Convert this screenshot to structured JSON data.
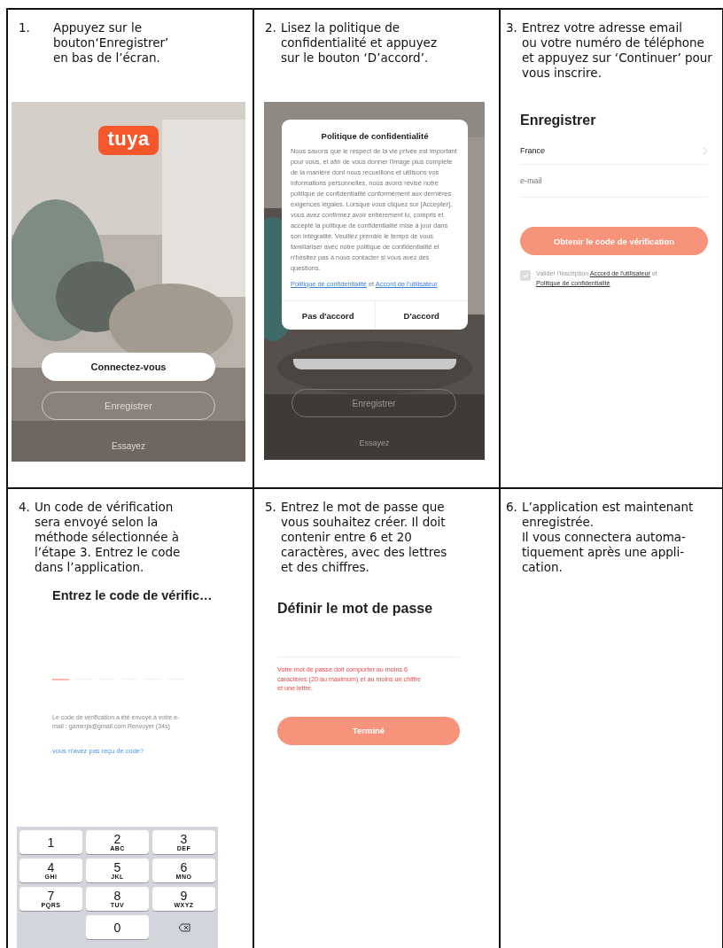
{
  "steps": [
    {
      "number": "1.",
      "text": "Appuyez sur le\nbouton‘Enregistrer’\nen bas de l’écran.",
      "screen": {
        "kind": "welcome",
        "logo": "tuya",
        "buttons": [
          {
            "label": "Connectez-vous",
            "kind": "solid"
          },
          {
            "label": "Enregistrer",
            "kind": "outline"
          }
        ],
        "link": "Essayez"
      }
    },
    {
      "number": "2.",
      "text": "Lisez la politique de\nconfidentialité et appuyez\nsur le bouton ‘D’accord’.",
      "screen": {
        "kind": "policy",
        "title": "Politique de confidentialité",
        "body": "Nous savons que le respect de la vie privée est important pour vous, et afin de vous donner l'image plus complète de la manière dont nous recueillons et utilisons vos informations personnelles, nous avons révisé notre politique de confidentialité conformément aux dernières exigences légales. Lorsque vous cliquez sur [Accepter], vous avez confirmez avoir entièrement lu, compris et accepté la politique de confidentialité mise à jour dans son intégralité. Veuillez prendre le temps de vous familiariser avec notre politique de confidentialité et n'hésitez pas à nous contacter si vous avez des questions.",
        "links": [
          "Politique de confidentialité",
          "et",
          "Accord de l'utilisateur"
        ],
        "buttons": [
          "Pas d'accord",
          "D'accord"
        ],
        "behind_button": "Enregistrer",
        "behind_link": "Essayez"
      }
    },
    {
      "number": "3.",
      "text": "Entrez votre adresse email\nou votre numéro de téléphone\net appuyez sur ‘Continuer’ pour\nvous inscrire.",
      "screen": {
        "kind": "register",
        "title": "Enregistrer",
        "country": "France",
        "placeholder": "e-mail",
        "button": "Obtenir le code de vérification",
        "agreement": {
          "checked": true,
          "text": "Valider l'inscription",
          "link1": "Accord de l'utilisateur",
          "joiner": "et",
          "link2": "Politique de confidentialité"
        }
      }
    },
    {
      "number": "4.",
      "text": "Un code de vérification\nsera envoyé selon la\nméthode sélectionnée à\nl’étape 3. Entrez le code\ndans l’application.",
      "screen": {
        "kind": "code",
        "title": "Entrez le code de vérific…",
        "info": "Le code de vérification a été envoyé à votre e-mail : gamerja@gmail.com  Renvoyer (34s)",
        "link": "vous n'avez pas reçu de code?",
        "keys": [
          {
            "digit": "1"
          },
          {
            "digit": "2",
            "letters": "ABC"
          },
          {
            "digit": "3",
            "letters": "DEF"
          },
          {
            "digit": "4",
            "letters": "GHI"
          },
          {
            "digit": "5",
            "letters": "JKL"
          },
          {
            "digit": "6",
            "letters": "MNO"
          },
          {
            "digit": "7",
            "letters": "PQRS"
          },
          {
            "digit": "8",
            "letters": "TUV"
          },
          {
            "digit": "9",
            "letters": "WXYZ"
          },
          {
            "digit": "0"
          }
        ]
      }
    },
    {
      "number": "5.",
      "text": "Entrez le mot de passe que\nvous souhaitez créer. Il doit\ncontenir entre 6 et 20\ncaractères, avec des lettres\net des chiffres.",
      "screen": {
        "kind": "password",
        "title": "Définir le mot de passe",
        "error": "Votre mot de passe doit comporter au moins 6 caractères (20 au maximum) et au moins un chiffre et une lettre.",
        "button": "Terminé"
      }
    },
    {
      "number": "6.",
      "text": "L’application est maintenant\nenregistrée.\nIl vous connectera automa-\ntiquement après une appli-\ncation."
    }
  ]
}
